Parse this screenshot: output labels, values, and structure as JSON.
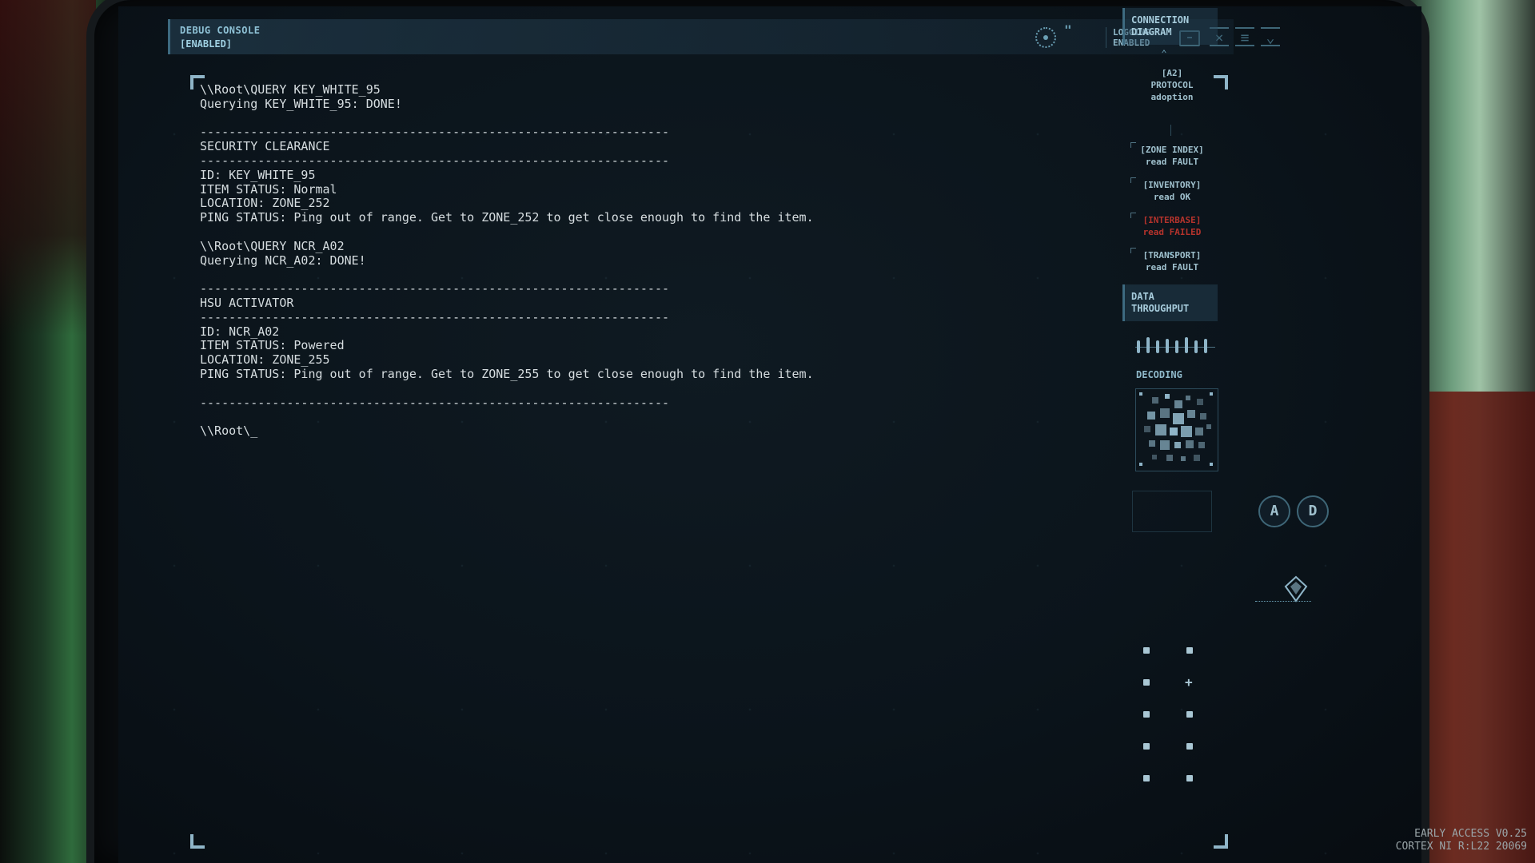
{
  "topbar": {
    "title": "DEBUG CONSOLE",
    "status": "[ENABLED]",
    "logging_line1": "LOGGING",
    "logging_line2": "ENABLED"
  },
  "console_lines": [
    "\\\\Root\\QUERY KEY_WHITE_95",
    "Querying KEY_WHITE_95: DONE!",
    "",
    "-----------------------------------------------------------------",
    "SECURITY CLEARANCE",
    "-----------------------------------------------------------------",
    "ID: KEY_WHITE_95",
    "ITEM STATUS: Normal",
    "LOCATION: ZONE_252",
    "PING STATUS: Ping out of range. Get to ZONE_252 to get close enough to find the item.",
    "",
    "\\\\Root\\QUERY NCR_A02",
    "Querying NCR_A02: DONE!",
    "",
    "-----------------------------------------------------------------",
    "HSU ACTIVATOR",
    "-----------------------------------------------------------------",
    "ID: NCR_A02",
    "ITEM STATUS: Powered",
    "LOCATION: ZONE_255",
    "PING STATUS: Ping out of range. Get to ZONE_255 to get close enough to find the item.",
    "",
    "-----------------------------------------------------------------",
    "",
    "\\\\Root\\_"
  ],
  "connection": {
    "title_line1": "CONNECTION",
    "title_line2": "DIAGRAM",
    "items": [
      {
        "a": "[A2]",
        "b": "PROTOCOL adoption",
        "state": "ok"
      },
      {
        "a": "[ZONE INDEX]",
        "b": "read FAULT",
        "state": "fault"
      },
      {
        "a": "[INVENTORY]",
        "b": "read OK",
        "state": "ok"
      },
      {
        "a": "[INTERBASE]",
        "b": "read FAILED",
        "state": "fail"
      },
      {
        "a": "[TRANSPORT]",
        "b": "read FAULT",
        "state": "fault"
      }
    ]
  },
  "throughput": {
    "title_line1": "DATA",
    "title_line2": "THROUGHPUT"
  },
  "decoding_label": "DECODING",
  "buttons": {
    "a_label": "A",
    "d_label": "D"
  },
  "version": {
    "line1": "EARLY ACCESS V0.25",
    "line2": "CORTEX NI R:L22 20069"
  },
  "colors": {
    "accent": "#8fc2d6",
    "console_text": "#d6dde0",
    "fail": "#b5332c"
  }
}
